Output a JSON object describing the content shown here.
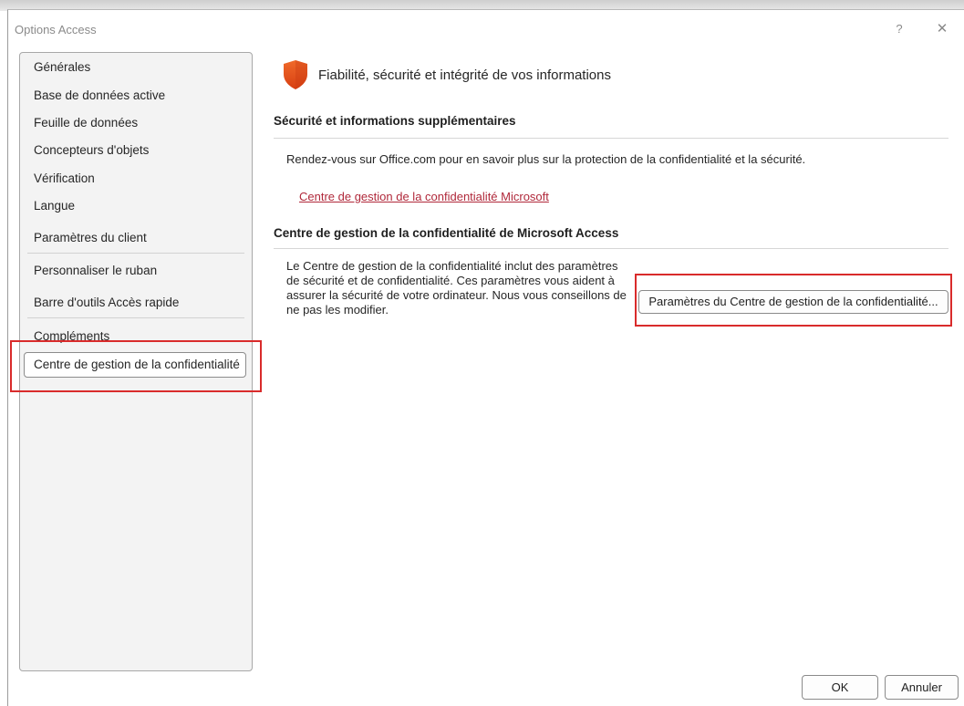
{
  "window": {
    "title": "Options Access",
    "help_label": "?",
    "close_label": "✕"
  },
  "sidebar": {
    "items": [
      {
        "label": "Générales"
      },
      {
        "label": "Base de données active"
      },
      {
        "label": "Feuille de données"
      },
      {
        "label": "Concepteurs d'objets"
      },
      {
        "label": "Vérification"
      },
      {
        "label": "Langue"
      },
      {
        "label": "Paramètres du client"
      },
      {
        "label": "Personnaliser le ruban"
      },
      {
        "label": "Barre d'outils Accès rapide"
      },
      {
        "label": "Compléments"
      },
      {
        "label": "Centre de gestion de la confidentialité"
      }
    ],
    "selected_index": 10
  },
  "main": {
    "heading": "Fiabilité, sécurité et intégrité de vos informations",
    "section1": {
      "title": "Sécurité et informations supplémentaires",
      "text": "Rendez-vous sur Office.com pour en savoir plus sur la protection de la confidentialité et la sécurité.",
      "link": "Centre de gestion de la confidentialité Microsoft"
    },
    "section2": {
      "title": "Centre de gestion de la confidentialité de Microsoft Access",
      "lines": [
        "Le Centre de gestion de la confidentialité inclut des paramètres",
        "de sécurité et de confidentialité. Ces paramètres vous aident à",
        "assurer la sécurité de votre ordinateur. Nous vous conseillons de",
        "ne pas les modifier."
      ],
      "button_label": "Paramètres du Centre de gestion de la confidentialité..."
    }
  },
  "footer": {
    "ok_label": "OK",
    "cancel_label": "Annuler"
  },
  "colors": {
    "shield": "#e8511e",
    "link": "#b0283a",
    "highlight": "#d92b2b"
  }
}
